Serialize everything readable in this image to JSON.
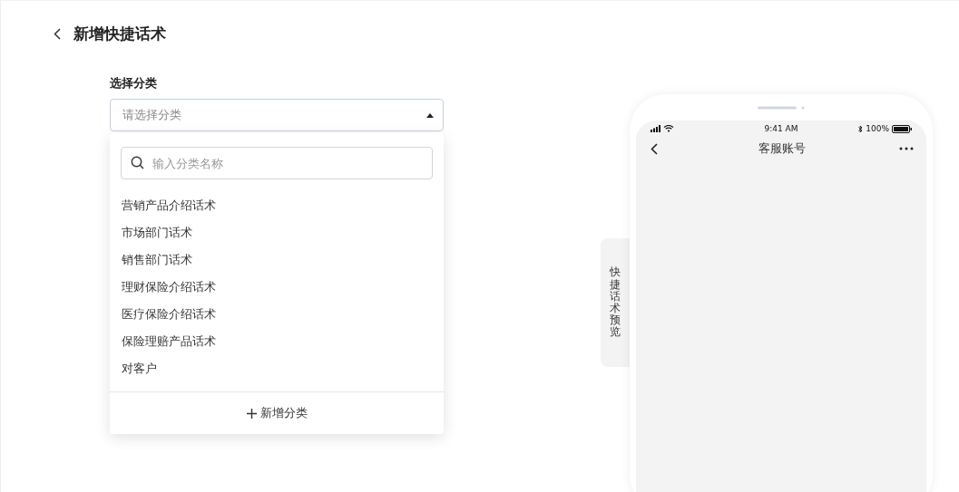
{
  "header": {
    "title": "新增快捷话术"
  },
  "category_select": {
    "label": "选择分类",
    "placeholder": "请选择分类",
    "expanded": true
  },
  "dropdown": {
    "search": {
      "placeholder": "输入分类名称"
    },
    "options": [
      {
        "label": "营销产品介绍话术",
        "selected": false
      },
      {
        "label": "市场部门话术",
        "selected": false
      },
      {
        "label": "销售部门话术",
        "selected": false
      },
      {
        "label": "理财保险介绍话术",
        "selected": false
      },
      {
        "label": "医疗保险介绍话术",
        "selected": false
      },
      {
        "label": "保险理赔产品话术",
        "selected": false
      },
      {
        "label": "对客户",
        "selected": false
      }
    ],
    "add_button": "新增分类"
  },
  "preview_tab": "快捷话术预览",
  "phone": {
    "status_time": "9:41 AM",
    "battery": "100%",
    "title": "客服账号"
  }
}
